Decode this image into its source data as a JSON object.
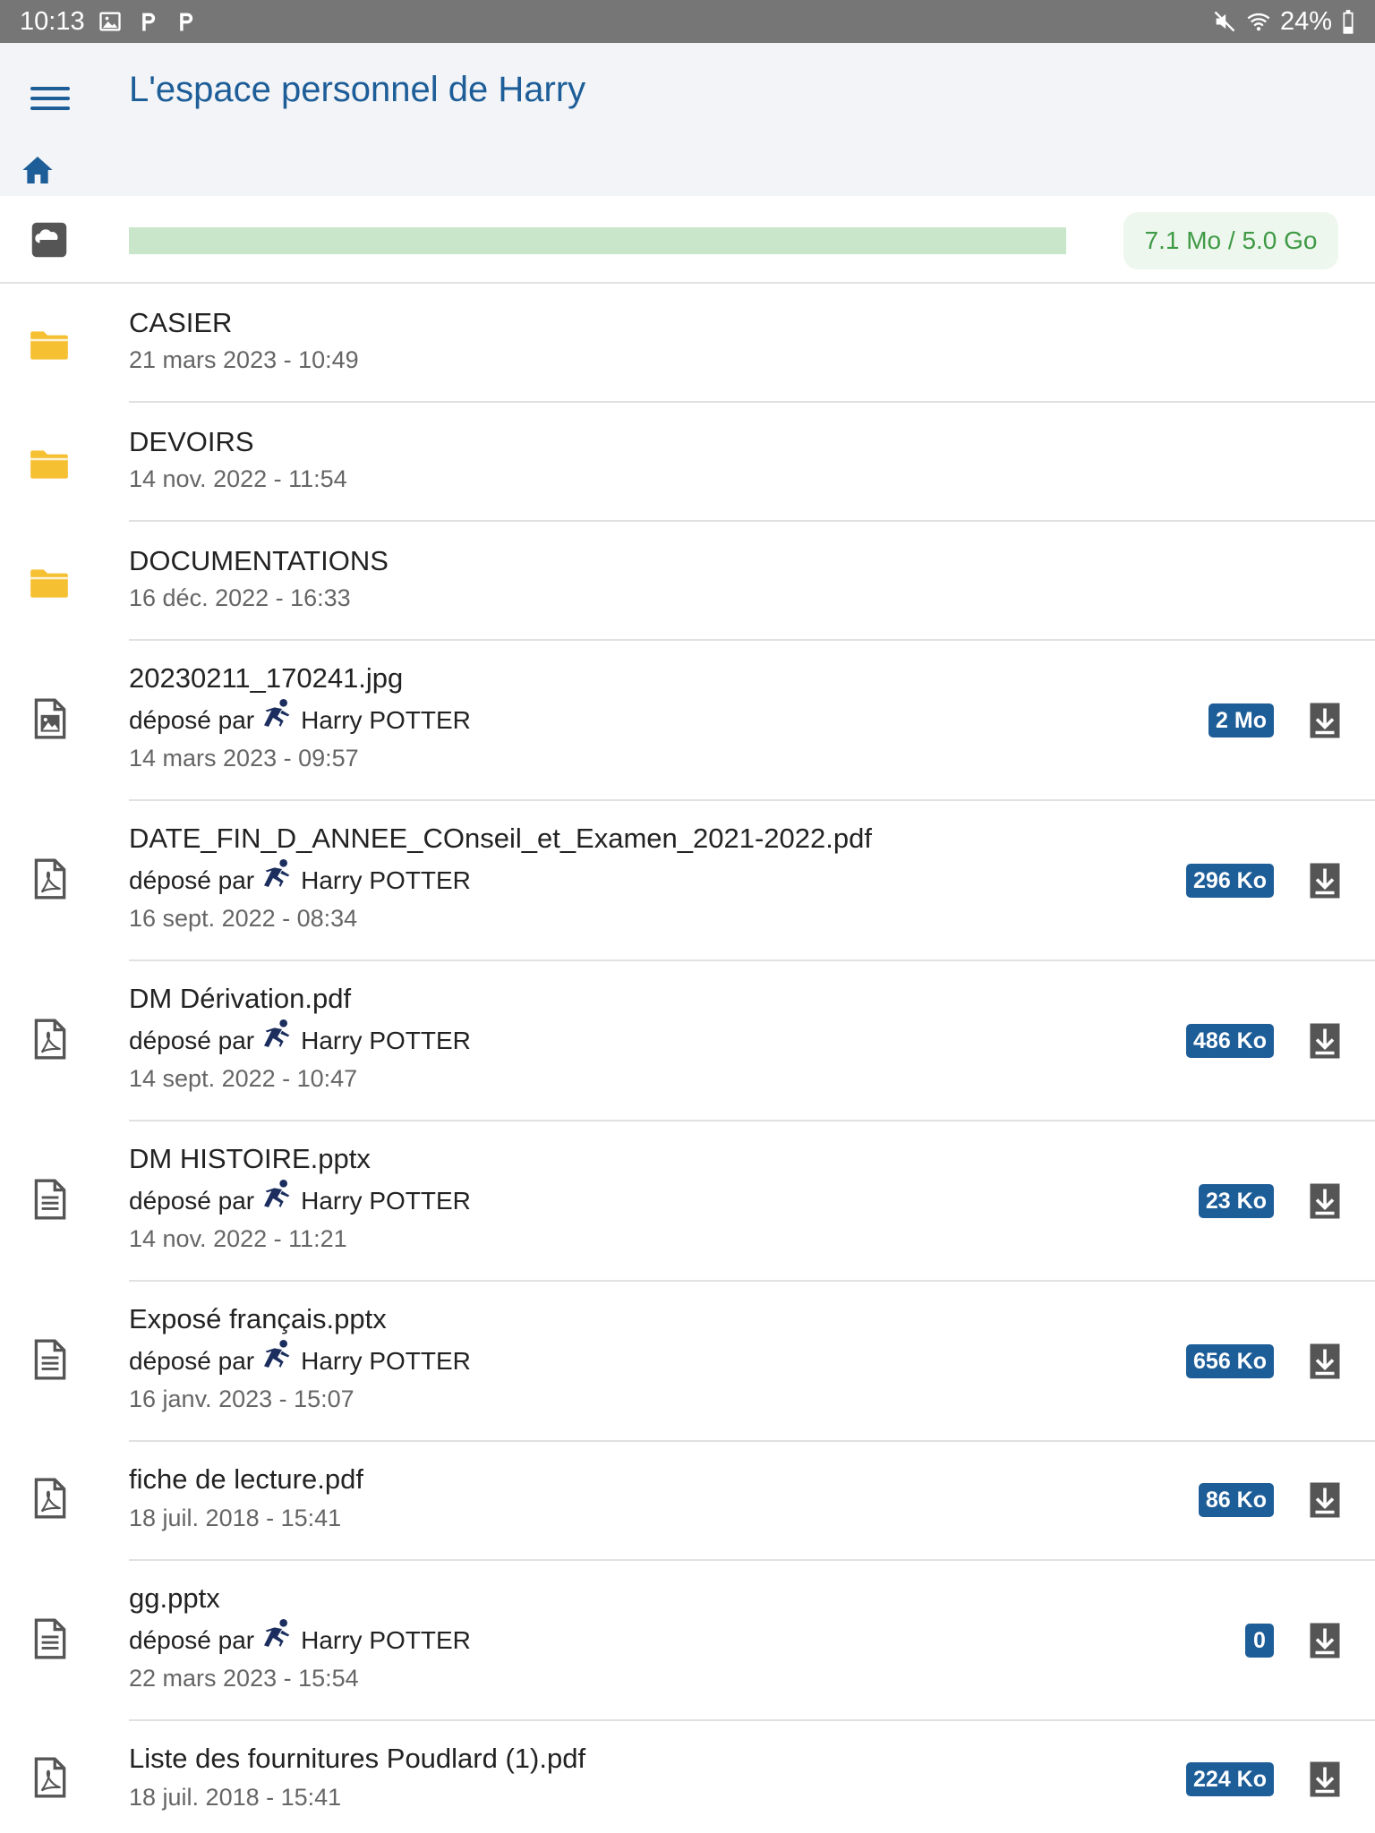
{
  "status_bar": {
    "time": "10:13",
    "battery": "24%"
  },
  "header": {
    "title": "L'espace personnel de Harry"
  },
  "storage": {
    "quota": "7.1 Mo / 5.0 Go",
    "used_fraction": 0.0014
  },
  "colors": {
    "accent": "#1d5d98",
    "folder": "#f6c033",
    "quota_text": "#3f9a45"
  },
  "folders": [
    {
      "name": "CASIER",
      "date": "21 mars 2023 - 10:49",
      "icon": "folder-icon"
    },
    {
      "name": "DEVOIRS",
      "date": "14 nov. 2022 - 11:54",
      "icon": "folder-icon"
    },
    {
      "name": "DOCUMENTATIONS",
      "date": "16 déc. 2022 - 16:33",
      "icon": "folder-icon"
    }
  ],
  "files": [
    {
      "name": "20230211_170241.jpg",
      "by_label": "déposé par",
      "author": "Harry POTTER",
      "date": "14 mars 2023 - 09:57",
      "size": "2 Mo",
      "icon": "image-file-icon"
    },
    {
      "name": "DATE_FIN_D_ANNEE_COnseil_et_Examen_2021-2022.pdf",
      "by_label": "déposé par",
      "author": "Harry POTTER",
      "date": "16 sept. 2022 - 08:34",
      "size": "296 Ko",
      "icon": "pdf-file-icon"
    },
    {
      "name": "DM Dérivation.pdf",
      "by_label": "déposé par",
      "author": "Harry POTTER",
      "date": "14 sept. 2022 - 10:47",
      "size": "486 Ko",
      "icon": "pdf-file-icon"
    },
    {
      "name": "DM HISTOIRE.pptx",
      "by_label": "déposé par",
      "author": "Harry POTTER",
      "date": "14 nov. 2022 - 11:21",
      "size": "23 Ko",
      "icon": "document-file-icon"
    },
    {
      "name": "Exposé français.pptx",
      "by_label": "déposé par",
      "author": "Harry POTTER",
      "date": "16 janv. 2023 - 15:07",
      "size": "656 Ko",
      "icon": "document-file-icon"
    },
    {
      "name": "fiche de lecture.pdf",
      "date": "18 juil. 2018 - 15:41",
      "size": "86 Ko",
      "icon": "pdf-file-icon"
    },
    {
      "name": "gg.pptx",
      "by_label": "déposé par",
      "author": "Harry POTTER",
      "date": "22 mars 2023 - 15:54",
      "size": "0",
      "icon": "document-file-icon"
    },
    {
      "name": "Liste des fournitures Poudlard (1).pdf",
      "date": "18 juil. 2018 - 15:41",
      "size": "224 Ko",
      "icon": "pdf-file-icon"
    }
  ]
}
